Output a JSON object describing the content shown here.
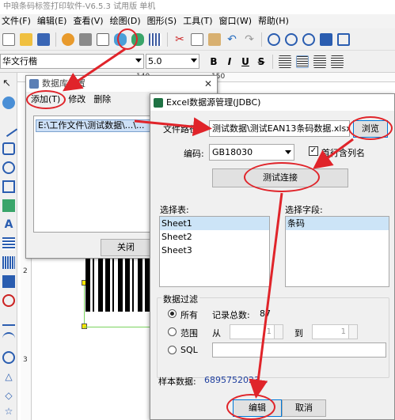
{
  "app": {
    "title": "中琅条码标签打印软件-V6.5.3 试用版 单机",
    "menu": [
      "文件(F)",
      "编辑(E)",
      "查看(V)",
      "绘图(D)",
      "图形(S)",
      "工具(T)",
      "窗口(W)",
      "帮助(H)"
    ],
    "font_name": "华文行楷",
    "font_size": "5.0",
    "format_buttons": [
      "B",
      "I",
      "U",
      "S"
    ]
  },
  "ruler": {
    "top_numbers": [
      "140",
      "150"
    ],
    "left_numbers": [
      "2",
      "3"
    ]
  },
  "datasource_dialog": {
    "title": "数据库设置",
    "menu": [
      "添加(T)",
      "修改",
      "删除"
    ],
    "list_items": [
      "E:\\工作文件\\测试数据\\...\\..."
    ],
    "close_label": "关闭"
  },
  "jdbc_dialog": {
    "title": "Excel数据源管理(JDBC)",
    "file_path_label": "文件路径:",
    "file_path_value": "测试数据\\测试EAN13条码数据.xlsx",
    "browse_label": "浏览",
    "encoding_label": "编码:",
    "encoding_value": "GB18030",
    "header_row_label": "首行含列名",
    "test_connection_label": "测试连接",
    "select_table_label": "选择表:",
    "tables": [
      "Sheet1",
      "Sheet2",
      "Sheet3"
    ],
    "select_field_label": "选择字段:",
    "fields": [
      "条码"
    ],
    "filter_group_label": "数据过滤",
    "filter_all_label": "所有",
    "record_count_label": "记录总数:",
    "record_count_value": "87",
    "filter_range_label": "范围",
    "range_from_label": "从",
    "range_from_value": "1",
    "range_to_label": "到",
    "range_to_value": "1",
    "filter_sql_label": "SQL",
    "sample_label": "样本数据:",
    "sample_value": "6895752023...",
    "edit_label": "编辑",
    "cancel_label": "取消"
  },
  "colors": {
    "annotation_red": "#e0242a",
    "selection_blue": "#cce4f7",
    "sample_value_blue": "#1f3f9f",
    "excel_green": "#1f7244"
  },
  "icons": [
    "new-icon",
    "open-icon",
    "save-icon",
    "settings-icon",
    "print-icon",
    "preview-icon",
    "database-icon",
    "database-settings-icon",
    "grid-icon",
    "cut-icon",
    "copy-icon",
    "paste-icon",
    "undo-icon",
    "redo-icon",
    "zoom-in-icon",
    "zoom-out-icon",
    "zoom-fit-icon",
    "zoom-actual-icon"
  ]
}
